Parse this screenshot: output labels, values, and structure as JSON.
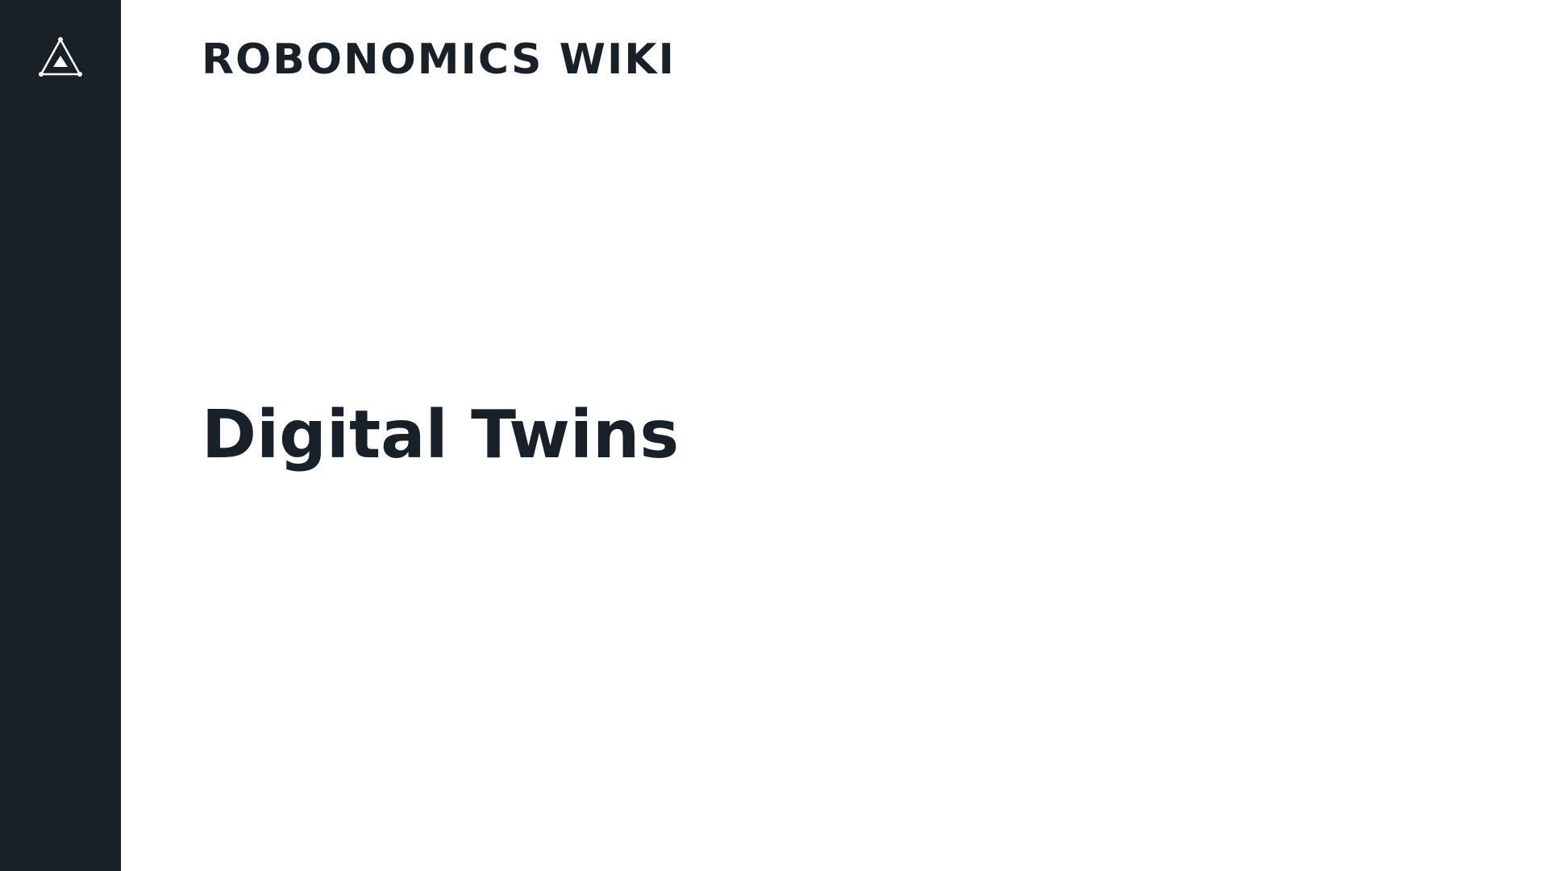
{
  "colors": {
    "sidebar_background": "#182127",
    "page_background": "#ffffff",
    "text": "#182127",
    "logo_stroke": "#ffffff"
  },
  "sidebar": {
    "logo_icon": "robonomics-triangle-logo-icon"
  },
  "header": {
    "title": "ROBONOMICS WIKI"
  },
  "main": {
    "heading": "Digital Twins"
  }
}
